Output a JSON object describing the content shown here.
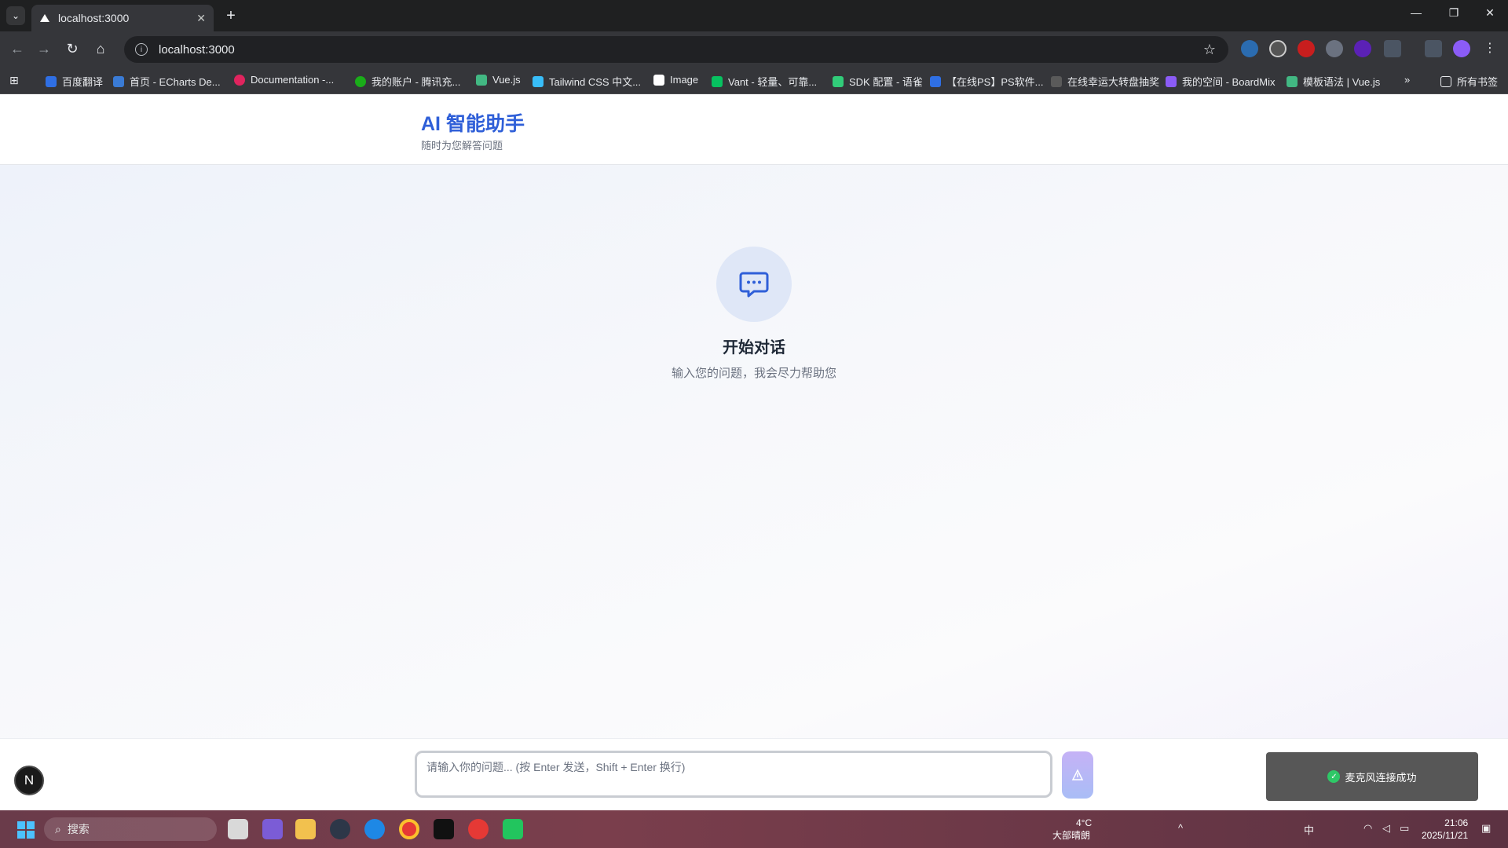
{
  "browser": {
    "tab_title": "localhost:3000",
    "tab_close": "✕",
    "new_tab": "+",
    "url": "localhost:3000",
    "bookmarks": [
      {
        "label": "百度翻译",
        "color": "#2f6fe4"
      },
      {
        "label": "首页 - ECharts De...",
        "color": "#3a7bd5"
      },
      {
        "label": "Documentation -...",
        "color": "#e0245e"
      },
      {
        "label": "我的账户 - 腾讯充...",
        "color": "#1aad19"
      },
      {
        "label": "Vue.js",
        "color": "#42b883"
      },
      {
        "label": "Tailwind CSS 中文...",
        "color": "#38bdf8"
      },
      {
        "label": "Image",
        "color": "#ffffff"
      },
      {
        "label": "Vant - 轻量、可靠...",
        "color": "#07c160"
      },
      {
        "label": "SDK 配置 - 语雀",
        "color": "#31cc79"
      },
      {
        "label": "【在线PS】PS软件...",
        "color": "#2f6fe4"
      },
      {
        "label": "在线幸运大转盘抽奖",
        "color": "#5a5a5a"
      },
      {
        "label": "我的空间 - BoardMix",
        "color": "#8b5cf6"
      },
      {
        "label": "模板语法 | Vue.js",
        "color": "#42b883"
      }
    ],
    "bookmarks_folder": "所有书签"
  },
  "app": {
    "title": "AI 智能助手",
    "subtitle": "随时为您解答问题",
    "empty_title": "开始对话",
    "empty_desc": "输入您的问题，我会尽力帮助您",
    "input_placeholder": "请输入你的问题... (按 Enter 发送，Shift + Enter 换行)",
    "avatar_letter": "N",
    "toast_text": "麦克风连接成功",
    "accent_color": "#2f5fd8"
  },
  "taskbar": {
    "search_label": "搜索",
    "weather_temp": "4°C",
    "weather_desc": "大部晴朗",
    "ime": "中",
    "time": "21:06",
    "date": "2025/11/21"
  }
}
